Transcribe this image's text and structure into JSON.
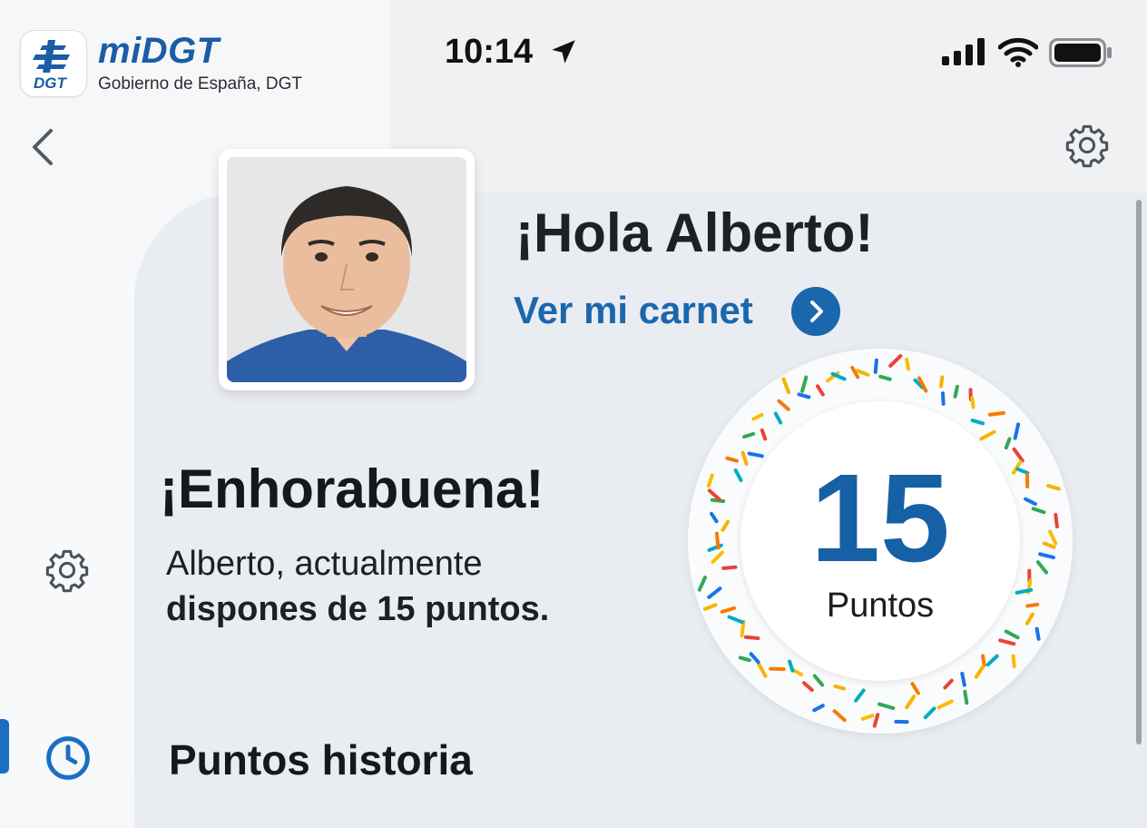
{
  "status_bar": {
    "time": "10:14"
  },
  "brand": {
    "app_name": "miDGT",
    "icon_text": "DGT",
    "subtitle": "Gobierno de España, DGT"
  },
  "profile": {
    "greeting": "¡Hola Alberto!",
    "carnet_link": "Ver mi carnet"
  },
  "points": {
    "title": "¡Enhorabuena!",
    "message_line1": "Alberto, actualmente",
    "message_line2": "dispones de 15 puntos.",
    "value": "15",
    "label": "Puntos"
  },
  "history": {
    "title": "Puntos historia"
  },
  "colors": {
    "brand_blue": "#1b5da6",
    "link_blue": "#1b67ad",
    "points_blue": "#1660a5",
    "confetti": [
      "#f4b400",
      "#1a73e8",
      "#34a853",
      "#ea4335",
      "#fbbc04",
      "#00acc1",
      "#f57c00"
    ]
  },
  "icons": {
    "back": "chevron-left-icon",
    "settings": "gear-icon",
    "history": "clock-icon",
    "location": "location-arrow-icon",
    "carnet": "chevron-right-circle-icon"
  }
}
